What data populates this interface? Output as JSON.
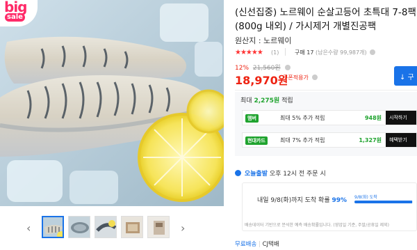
{
  "product": {
    "title": "(신선집중) 노르웨이 순살고등어 초특대 7-8팩(800g 내외) / 가시제거 개별진공팩",
    "origin": "원산지 : 노르웨이",
    "rating_stars": "★★★★★",
    "review_count": "(1)",
    "purchase_label": "구매 17",
    "purchase_sub": "(남은수량 99,987개)"
  },
  "promo": {
    "big": "big",
    "sale": "sale"
  },
  "pricing": {
    "discount_percent": "12%",
    "original_price": "21,560원",
    "price": "18,970원",
    "after_coupon": "쿠폰적용가"
  },
  "actions": {
    "buy_label": "↓ 구"
  },
  "rewards": {
    "head_label": "최대",
    "head_amount": "2,275원",
    "head_suffix": "적립",
    "rows": [
      {
        "badge": "멤버",
        "desc": "최대 5% 추가 적립",
        "value": "948원",
        "action": "시작하기"
      },
      {
        "badge": "현대카드",
        "desc": "최대 7% 추가 적립",
        "value": "1,327원",
        "action": "혜택받기"
      }
    ]
  },
  "delivery": {
    "name": "오늘출발",
    "desc": "오후 12시 전 주문 시",
    "arrival_text": "내일 9/8(화)까지 도착 확률",
    "arrival_percent": "99%",
    "arrival_fraction": 0.99,
    "arrival_tag": "9/8(화) 도착",
    "note": "배송데이터 기반으로 분석한 예측 배송확률입니다. (영업일 기준, 주말/공휴일 제외)"
  },
  "shipping": {
    "free": "무료배송",
    "carrier": "CJ택배"
  },
  "gallery": {
    "prev_icon": "‹",
    "next_icon": "›",
    "count": 5
  },
  "colors": {
    "accent": "#1a73e8",
    "price": "#ee2211",
    "reward": "#1fa32e",
    "promo": "#ff2a68"
  }
}
